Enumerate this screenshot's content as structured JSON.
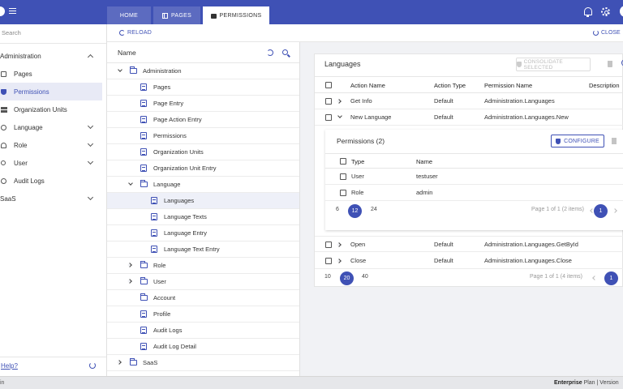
{
  "tabs": [
    {
      "label": "HOME"
    },
    {
      "label": "PAGES"
    },
    {
      "label": "PERMISSIONS"
    }
  ],
  "sidebar": {
    "search_placeholder": "Search",
    "items": [
      {
        "label": "Administration"
      },
      {
        "label": "Pages"
      },
      {
        "label": "Permissions"
      },
      {
        "label": "Organization Units"
      },
      {
        "label": "Language"
      },
      {
        "label": "Role"
      },
      {
        "label": "User"
      },
      {
        "label": "Audit Logs"
      },
      {
        "label": "SaaS"
      }
    ],
    "help_label": "Help?"
  },
  "toolbar": {
    "reload_label": "RELOAD",
    "close_label": "CLOSE"
  },
  "tree": {
    "header": "Name",
    "rows": [
      {
        "label": "Administration"
      },
      {
        "label": "Pages"
      },
      {
        "label": "Page Entry"
      },
      {
        "label": "Page Action Entry"
      },
      {
        "label": "Permissions"
      },
      {
        "label": "Organization Units"
      },
      {
        "label": "Organization Unit Entry"
      },
      {
        "label": "Language"
      },
      {
        "label": "Languages"
      },
      {
        "label": "Language Texts"
      },
      {
        "label": "Language Entry"
      },
      {
        "label": "Language Text Entry"
      },
      {
        "label": "Role"
      },
      {
        "label": "User"
      },
      {
        "label": "Account"
      },
      {
        "label": "Profile"
      },
      {
        "label": "Audit Logs"
      },
      {
        "label": "Audit Log Detail"
      },
      {
        "label": "SaaS"
      }
    ]
  },
  "detail": {
    "title": "Languages",
    "consolidate_label": "CONSOLIDATE SELECTED",
    "columns": [
      "Action Name",
      "Action Type",
      "Permission Name",
      "Description"
    ],
    "rows": [
      {
        "name": "Get Info",
        "type": "Default",
        "permission": "Administration.Languages"
      },
      {
        "name": "New Language",
        "type": "Default",
        "permission": "Administration.Languages.New"
      },
      {
        "name": "Open",
        "type": "Default",
        "permission": "Administration.Languages.GetById"
      },
      {
        "name": "Close",
        "type": "Default",
        "permission": "Administration.Languages.Close"
      }
    ],
    "permissions": {
      "title": "Permissions (2)",
      "configure_label": "CONFIGURE",
      "columns": [
        "Type",
        "Name"
      ],
      "rows": [
        {
          "type": "User",
          "name": "testuser"
        },
        {
          "type": "Role",
          "name": "admin"
        }
      ],
      "pager": {
        "sizes": [
          "6",
          "12",
          "24"
        ],
        "selected": "12",
        "info": "Page 1 of 1 (2 items)",
        "page": "1"
      }
    },
    "pager": {
      "sizes": [
        "10",
        "20",
        "40"
      ],
      "selected": "20",
      "info": "Page 1 of 1 (4 items)",
      "page": "1"
    }
  },
  "status": {
    "left": "in",
    "plan_bold": "Enterprise",
    "plan_rest": " Plan | Version"
  }
}
